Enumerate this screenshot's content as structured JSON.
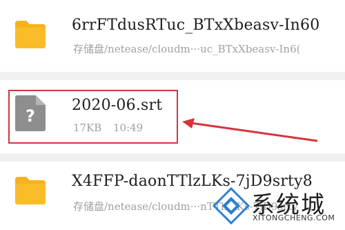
{
  "files": [
    {
      "name": "6rrFTdusRTuc_BTxXbeasv-In60",
      "path": "存储盘/netease/cloudm···uc_BTxXbeasv-In6(",
      "icon": "folder-icon"
    },
    {
      "name": "2020-06.srt",
      "size": "17KB",
      "time": "10:49",
      "icon": "unknown-file-icon"
    },
    {
      "name": "X4FFP-daonTTlzLKs-7jD9srty8",
      "path": "存储盘/netease/cloudm···nTTlzLKs-7jD9srty",
      "icon": "folder-icon"
    }
  ],
  "watermark": {
    "text": "系统城",
    "sub": "XITONGCHENG.COM"
  },
  "colors": {
    "folder": "#f7b21a",
    "highlight": "#d4343a",
    "file": "#8e8e8e"
  }
}
